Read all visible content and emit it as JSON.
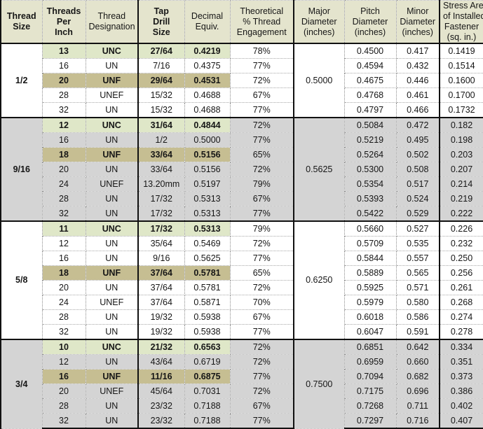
{
  "colors": {
    "header_bg": "#e4e4cd",
    "block_gray": "#d4d4d4",
    "block_white": "#ffffff",
    "unc_highlight": "#dfe7c8",
    "unf_highlight": "#c6be92",
    "border": "#111111",
    "text": "#161616"
  },
  "table": {
    "headers": [
      {
        "key": "thread_size",
        "lines": [
          "Thread",
          "Size"
        ],
        "bold": true
      },
      {
        "key": "tpi",
        "lines": [
          "Threads",
          "Per",
          "Inch"
        ],
        "bold": true
      },
      {
        "key": "designation",
        "lines": [
          "Thread",
          "Designation"
        ],
        "bold": false
      },
      {
        "key": "tap_drill",
        "lines": [
          "Tap",
          "Drill",
          "Size"
        ],
        "bold": true
      },
      {
        "key": "decimal",
        "lines": [
          "Decimal",
          "Equiv."
        ],
        "bold": false
      },
      {
        "key": "engagement",
        "lines": [
          "Theoretical",
          "% Thread",
          "Engagement"
        ],
        "bold": false
      },
      {
        "key": "major_dia",
        "lines": [
          "Major",
          "Diameter",
          "(inches)"
        ],
        "bold": false
      },
      {
        "key": "pitch_dia",
        "lines": [
          "Pitch",
          "Diameter",
          "(inches)"
        ],
        "bold": false
      },
      {
        "key": "minor_dia",
        "lines": [
          "Minor",
          "Diameter",
          "(inches)"
        ],
        "bold": false
      },
      {
        "key": "stress_area",
        "lines": [
          "Stress Area",
          "of Installed",
          "Fastener",
          "(sq. in.)"
        ],
        "bold": false
      }
    ],
    "blocks": [
      {
        "thread_size": "1/2",
        "major_diameter": "0.5000",
        "shade": "white",
        "rows": [
          {
            "tpi": "13",
            "designation": "UNC",
            "tap_drill": "27/64",
            "decimal": "0.4219",
            "engagement": "78%",
            "pitch_diameter": "0.4500",
            "minor_diameter": "0.417",
            "stress_area": "0.1419",
            "highlight": "unc"
          },
          {
            "tpi": "16",
            "designation": "UN",
            "tap_drill": "7/16",
            "decimal": "0.4375",
            "engagement": "77%",
            "pitch_diameter": "0.4594",
            "minor_diameter": "0.432",
            "stress_area": "0.1514",
            "highlight": ""
          },
          {
            "tpi": "20",
            "designation": "UNF",
            "tap_drill": "29/64",
            "decimal": "0.4531",
            "engagement": "72%",
            "pitch_diameter": "0.4675",
            "minor_diameter": "0.446",
            "stress_area": "0.1600",
            "highlight": "unf"
          },
          {
            "tpi": "28",
            "designation": "UNEF",
            "tap_drill": "15/32",
            "decimal": "0.4688",
            "engagement": "67%",
            "pitch_diameter": "0.4768",
            "minor_diameter": "0.461",
            "stress_area": "0.1700",
            "highlight": ""
          },
          {
            "tpi": "32",
            "designation": "UN",
            "tap_drill": "15/32",
            "decimal": "0.4688",
            "engagement": "77%",
            "pitch_diameter": "0.4797",
            "minor_diameter": "0.466",
            "stress_area": "0.1732",
            "highlight": ""
          }
        ]
      },
      {
        "thread_size": "9/16",
        "major_diameter": "0.5625",
        "shade": "gray",
        "rows": [
          {
            "tpi": "12",
            "designation": "UNC",
            "tap_drill": "31/64",
            "decimal": "0.4844",
            "engagement": "72%",
            "pitch_diameter": "0.5084",
            "minor_diameter": "0.472",
            "stress_area": "0.182",
            "highlight": "unc"
          },
          {
            "tpi": "16",
            "designation": "UN",
            "tap_drill": "1/2",
            "decimal": "0.5000",
            "engagement": "77%",
            "pitch_diameter": "0.5219",
            "minor_diameter": "0.495",
            "stress_area": "0.198",
            "highlight": ""
          },
          {
            "tpi": "18",
            "designation": "UNF",
            "tap_drill": "33/64",
            "decimal": "0.5156",
            "engagement": "65%",
            "pitch_diameter": "0.5264",
            "minor_diameter": "0.502",
            "stress_area": "0.203",
            "highlight": "unf"
          },
          {
            "tpi": "20",
            "designation": "UN",
            "tap_drill": "33/64",
            "decimal": "0.5156",
            "engagement": "72%",
            "pitch_diameter": "0.5300",
            "minor_diameter": "0.508",
            "stress_area": "0.207",
            "highlight": ""
          },
          {
            "tpi": "24",
            "designation": "UNEF",
            "tap_drill": "13.20mm",
            "decimal": "0.5197",
            "engagement": "79%",
            "pitch_diameter": "0.5354",
            "minor_diameter": "0.517",
            "stress_area": "0.214",
            "highlight": ""
          },
          {
            "tpi": "28",
            "designation": "UN",
            "tap_drill": "17/32",
            "decimal": "0.5313",
            "engagement": "67%",
            "pitch_diameter": "0.5393",
            "minor_diameter": "0.524",
            "stress_area": "0.219",
            "highlight": ""
          },
          {
            "tpi": "32",
            "designation": "UN",
            "tap_drill": "17/32",
            "decimal": "0.5313",
            "engagement": "77%",
            "pitch_diameter": "0.5422",
            "minor_diameter": "0.529",
            "stress_area": "0.222",
            "highlight": ""
          }
        ]
      },
      {
        "thread_size": "5/8",
        "major_diameter": "0.6250",
        "shade": "white",
        "rows": [
          {
            "tpi": "11",
            "designation": "UNC",
            "tap_drill": "17/32",
            "decimal": "0.5313",
            "engagement": "79%",
            "pitch_diameter": "0.5660",
            "minor_diameter": "0.527",
            "stress_area": "0.226",
            "highlight": "unc"
          },
          {
            "tpi": "12",
            "designation": "UN",
            "tap_drill": "35/64",
            "decimal": "0.5469",
            "engagement": "72%",
            "pitch_diameter": "0.5709",
            "minor_diameter": "0.535",
            "stress_area": "0.232",
            "highlight": ""
          },
          {
            "tpi": "16",
            "designation": "UN",
            "tap_drill": "9/16",
            "decimal": "0.5625",
            "engagement": "77%",
            "pitch_diameter": "0.5844",
            "minor_diameter": "0.557",
            "stress_area": "0.250",
            "highlight": ""
          },
          {
            "tpi": "18",
            "designation": "UNF",
            "tap_drill": "37/64",
            "decimal": "0.5781",
            "engagement": "65%",
            "pitch_diameter": "0.5889",
            "minor_diameter": "0.565",
            "stress_area": "0.256",
            "highlight": "unf"
          },
          {
            "tpi": "20",
            "designation": "UN",
            "tap_drill": "37/64",
            "decimal": "0.5781",
            "engagement": "72%",
            "pitch_diameter": "0.5925",
            "minor_diameter": "0.571",
            "stress_area": "0.261",
            "highlight": ""
          },
          {
            "tpi": "24",
            "designation": "UNEF",
            "tap_drill": "37/64",
            "decimal": "0.5871",
            "engagement": "70%",
            "pitch_diameter": "0.5979",
            "minor_diameter": "0.580",
            "stress_area": "0.268",
            "highlight": ""
          },
          {
            "tpi": "28",
            "designation": "UN",
            "tap_drill": "19/32",
            "decimal": "0.5938",
            "engagement": "67%",
            "pitch_diameter": "0.6018",
            "minor_diameter": "0.586",
            "stress_area": "0.274",
            "highlight": ""
          },
          {
            "tpi": "32",
            "designation": "UN",
            "tap_drill": "19/32",
            "decimal": "0.5938",
            "engagement": "77%",
            "pitch_diameter": "0.6047",
            "minor_diameter": "0.591",
            "stress_area": "0.278",
            "highlight": ""
          }
        ]
      },
      {
        "thread_size": "3/4",
        "major_diameter": "0.7500",
        "shade": "gray",
        "rows": [
          {
            "tpi": "10",
            "designation": "UNC",
            "tap_drill": "21/32",
            "decimal": "0.6563",
            "engagement": "72%",
            "pitch_diameter": "0.6851",
            "minor_diameter": "0.642",
            "stress_area": "0.334",
            "highlight": "unc"
          },
          {
            "tpi": "12",
            "designation": "UN",
            "tap_drill": "43/64",
            "decimal": "0.6719",
            "engagement": "72%",
            "pitch_diameter": "0.6959",
            "minor_diameter": "0.660",
            "stress_area": "0.351",
            "highlight": ""
          },
          {
            "tpi": "16",
            "designation": "UNF",
            "tap_drill": "11/16",
            "decimal": "0.6875",
            "engagement": "77%",
            "pitch_diameter": "0.7094",
            "minor_diameter": "0.682",
            "stress_area": "0.373",
            "highlight": "unf"
          },
          {
            "tpi": "20",
            "designation": "UNEF",
            "tap_drill": "45/64",
            "decimal": "0.7031",
            "engagement": "72%",
            "pitch_diameter": "0.7175",
            "minor_diameter": "0.696",
            "stress_area": "0.386",
            "highlight": ""
          },
          {
            "tpi": "28",
            "designation": "UN",
            "tap_drill": "23/32",
            "decimal": "0.7188",
            "engagement": "67%",
            "pitch_diameter": "0.7268",
            "minor_diameter": "0.711",
            "stress_area": "0.402",
            "highlight": ""
          },
          {
            "tpi": "32",
            "designation": "UN",
            "tap_drill": "23/32",
            "decimal": "0.7188",
            "engagement": "77%",
            "pitch_diameter": "0.7297",
            "minor_diameter": "0.716",
            "stress_area": "0.407",
            "highlight": ""
          }
        ]
      }
    ]
  }
}
